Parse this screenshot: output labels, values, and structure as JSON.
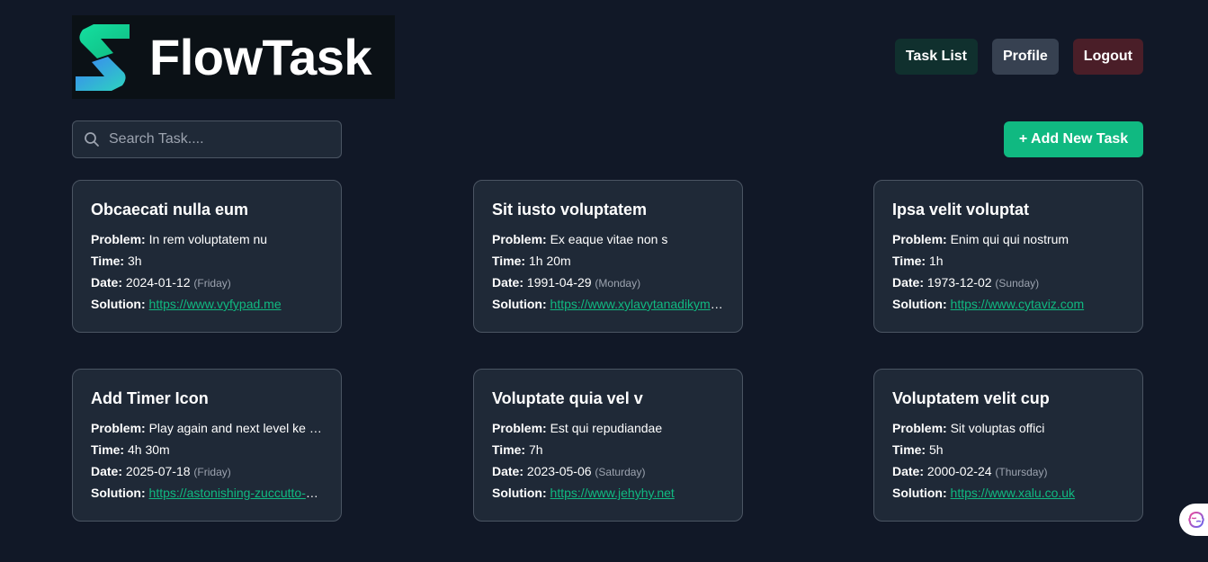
{
  "header": {
    "logo_text": "FlowTask",
    "nav": {
      "task_list": "Task List",
      "profile": "Profile",
      "logout": "Logout"
    }
  },
  "toolbar": {
    "search_placeholder": "Search Task....",
    "add_button": "+ Add New Task"
  },
  "labels": {
    "problem": "Problem:",
    "time": "Time:",
    "date": "Date:",
    "solution": "Solution:"
  },
  "tasks": [
    {
      "title": "Obcaecati nulla eum",
      "problem": "In rem voluptatem nu",
      "time": "3h",
      "date": "2024-01-12",
      "day": "(Friday)",
      "solution": "https://www.vyfypad.me"
    },
    {
      "title": "Sit iusto voluptatem",
      "problem": "Ex eaque vitae non s",
      "time": "1h 20m",
      "date": "1991-04-29",
      "day": "(Monday)",
      "solution": "https://www.xylavytanadikym.com"
    },
    {
      "title": "Ipsa velit voluptat",
      "problem": "Enim qui qui nostrum",
      "time": "1h",
      "date": "1973-12-02",
      "day": "(Sunday)",
      "solution": "https://www.cytaviz.com"
    },
    {
      "title": "Add Timer Icon",
      "problem": "Play again and next level ke sathe",
      "time": "4h 30m",
      "date": "2025-07-18",
      "day": "(Friday)",
      "solution": "https://astonishing-zuccutto-app.netlify.app"
    },
    {
      "title": "Voluptate quia vel v",
      "problem": "Est qui repudiandae",
      "time": "7h",
      "date": "2023-05-06",
      "day": "(Saturday)",
      "solution": "https://www.jehyhy.net"
    },
    {
      "title": "Voluptatem velit cup",
      "problem": "Sit voluptas offici",
      "time": "5h",
      "date": "2000-02-24",
      "day": "(Thursday)",
      "solution": "https://www.xalu.co.uk"
    }
  ],
  "colors": {
    "background": "#111827",
    "card": "#1f2937",
    "accent": "#10b981",
    "tasklist_button": "#10302e",
    "profile_button": "#374151",
    "logout_button": "#4a1e28"
  },
  "icons": {
    "logo": "flowtask-s-logo-icon",
    "search": "search-icon",
    "floating": "brain-icon"
  }
}
